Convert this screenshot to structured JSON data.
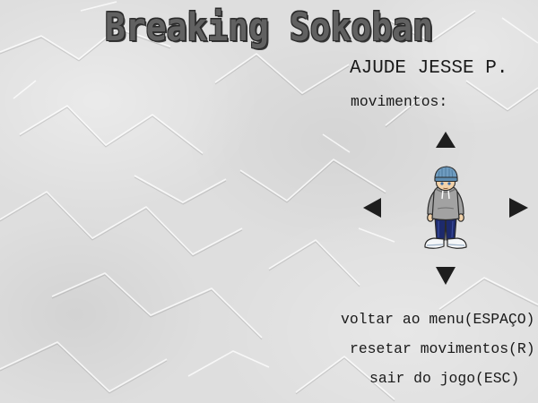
{
  "title": "Breaking Sokoban",
  "help": {
    "heading": "AJUDE JESSE P.",
    "moves_label": "movimentos:"
  },
  "controls": {
    "up_icon": "arrow-up-icon",
    "down_icon": "arrow-down-icon",
    "left_icon": "arrow-left-icon",
    "right_icon": "arrow-right-icon",
    "player_icon": "player-character-icon"
  },
  "options": {
    "back_to_menu": "voltar ao menu(ESPAÇO)",
    "reset_moves": "resetar movimentos(R)",
    "quit_game": "sair do jogo(ESC)"
  },
  "colors": {
    "background": "#dedede",
    "title_fill": "#616161",
    "title_outline": "#2a2a2a",
    "text": "#1a1a1a",
    "arrow": "#1e1e1e",
    "beanie": "#6f9cc0",
    "hoodie": "#a2a2a2",
    "pants": "#1d2a6c",
    "shoes": "#f4f6f8"
  }
}
